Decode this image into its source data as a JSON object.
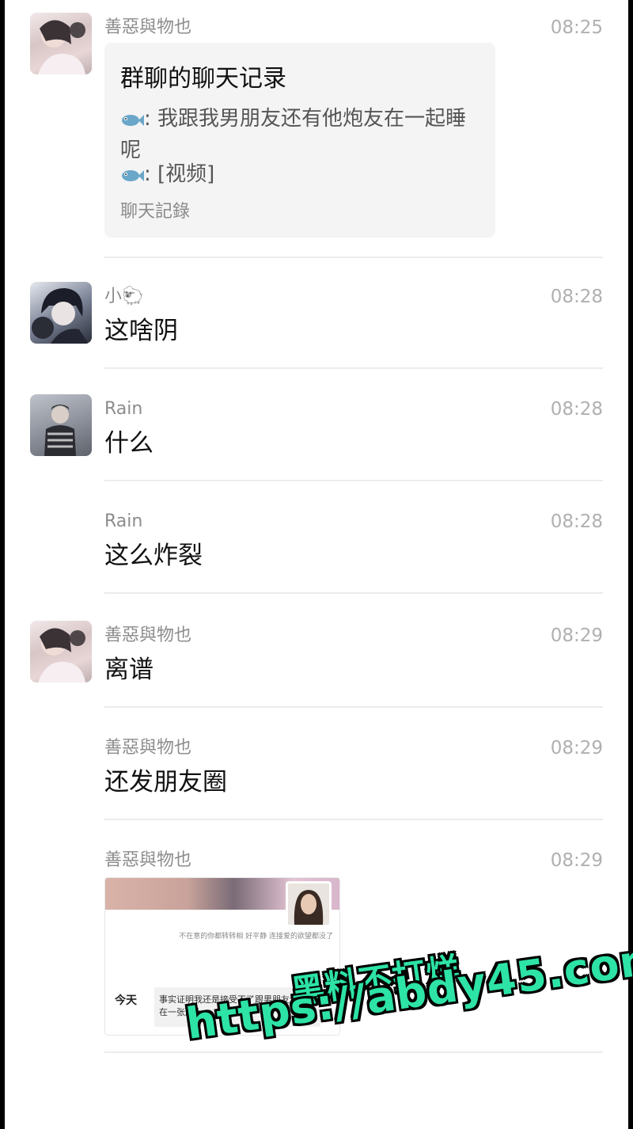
{
  "messages": [
    {
      "sender": "善惡與物也",
      "time": "08:25",
      "record": {
        "title": "群聊的聊天记录",
        "line1": ": 我跟我男朋友还有他炮友在一起睡呢",
        "line2": ": [视频]",
        "footer": "聊天記錄"
      }
    },
    {
      "sender": "小🐑",
      "time": "08:28",
      "text": "这啥阴"
    },
    {
      "sender": "Rain",
      "time": "08:28",
      "text": "什么"
    },
    {
      "sender": "Rain",
      "time": "08:28",
      "text": "这么炸裂"
    },
    {
      "sender": "善惡與物也",
      "time": "08:29",
      "text": "离谱"
    },
    {
      "sender": "善惡與物也",
      "time": "08:29",
      "text": "还发朋友圈"
    },
    {
      "sender": "善惡與物也",
      "time": "08:29",
      "screenshot": {
        "signature": "不在意的你都转转相 好平静 连接爱的欲望都没了",
        "today_label": "今天",
        "post_text": "事实证明我还是接受不了跟男朋友炮友躺在一张床上"
      }
    }
  ],
  "watermark": {
    "line1": "黑料不打烊",
    "line2": "https://abdy45.com"
  },
  "colors": {
    "name": "#8c8c8c",
    "time": "#b0b0b0",
    "watermark": "#2de3a5"
  }
}
